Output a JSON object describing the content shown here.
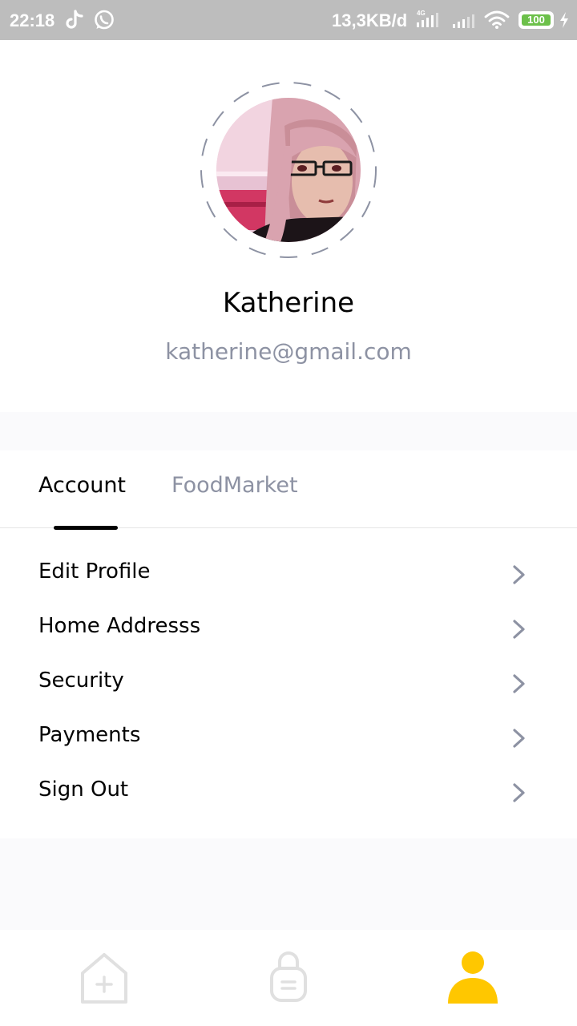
{
  "status_bar": {
    "time": "22:18",
    "network_speed": "13,3KB/d",
    "network_type": "4G",
    "battery": "100",
    "icons": [
      "tiktok-icon",
      "whatsapp-icon",
      "signal-icon",
      "wifi-icon",
      "battery-icon",
      "charging-icon"
    ]
  },
  "profile": {
    "name": "Katherine",
    "email": "katherine@gmail.com"
  },
  "tabs": [
    {
      "label": "Account",
      "active": true
    },
    {
      "label": "FoodMarket",
      "active": false
    }
  ],
  "menu": [
    {
      "label": "Edit Profile",
      "icon": "chevron-right-icon"
    },
    {
      "label": "Home Addresss",
      "icon": "chevron-right-icon"
    },
    {
      "label": "Security",
      "icon": "chevron-right-icon"
    },
    {
      "label": "Payments",
      "icon": "chevron-right-icon"
    },
    {
      "label": "Sign Out",
      "icon": "chevron-right-icon"
    }
  ],
  "bottom_nav": [
    {
      "icon": "home-icon",
      "active": false
    },
    {
      "icon": "order-bag-icon",
      "active": false
    },
    {
      "icon": "profile-icon",
      "active": true
    }
  ],
  "colors": {
    "accent": "#FFC700",
    "text_primary": "#020202",
    "text_secondary": "#8D92A3",
    "background": "#FAFAFC",
    "status_bar": "#BDBDBD"
  }
}
